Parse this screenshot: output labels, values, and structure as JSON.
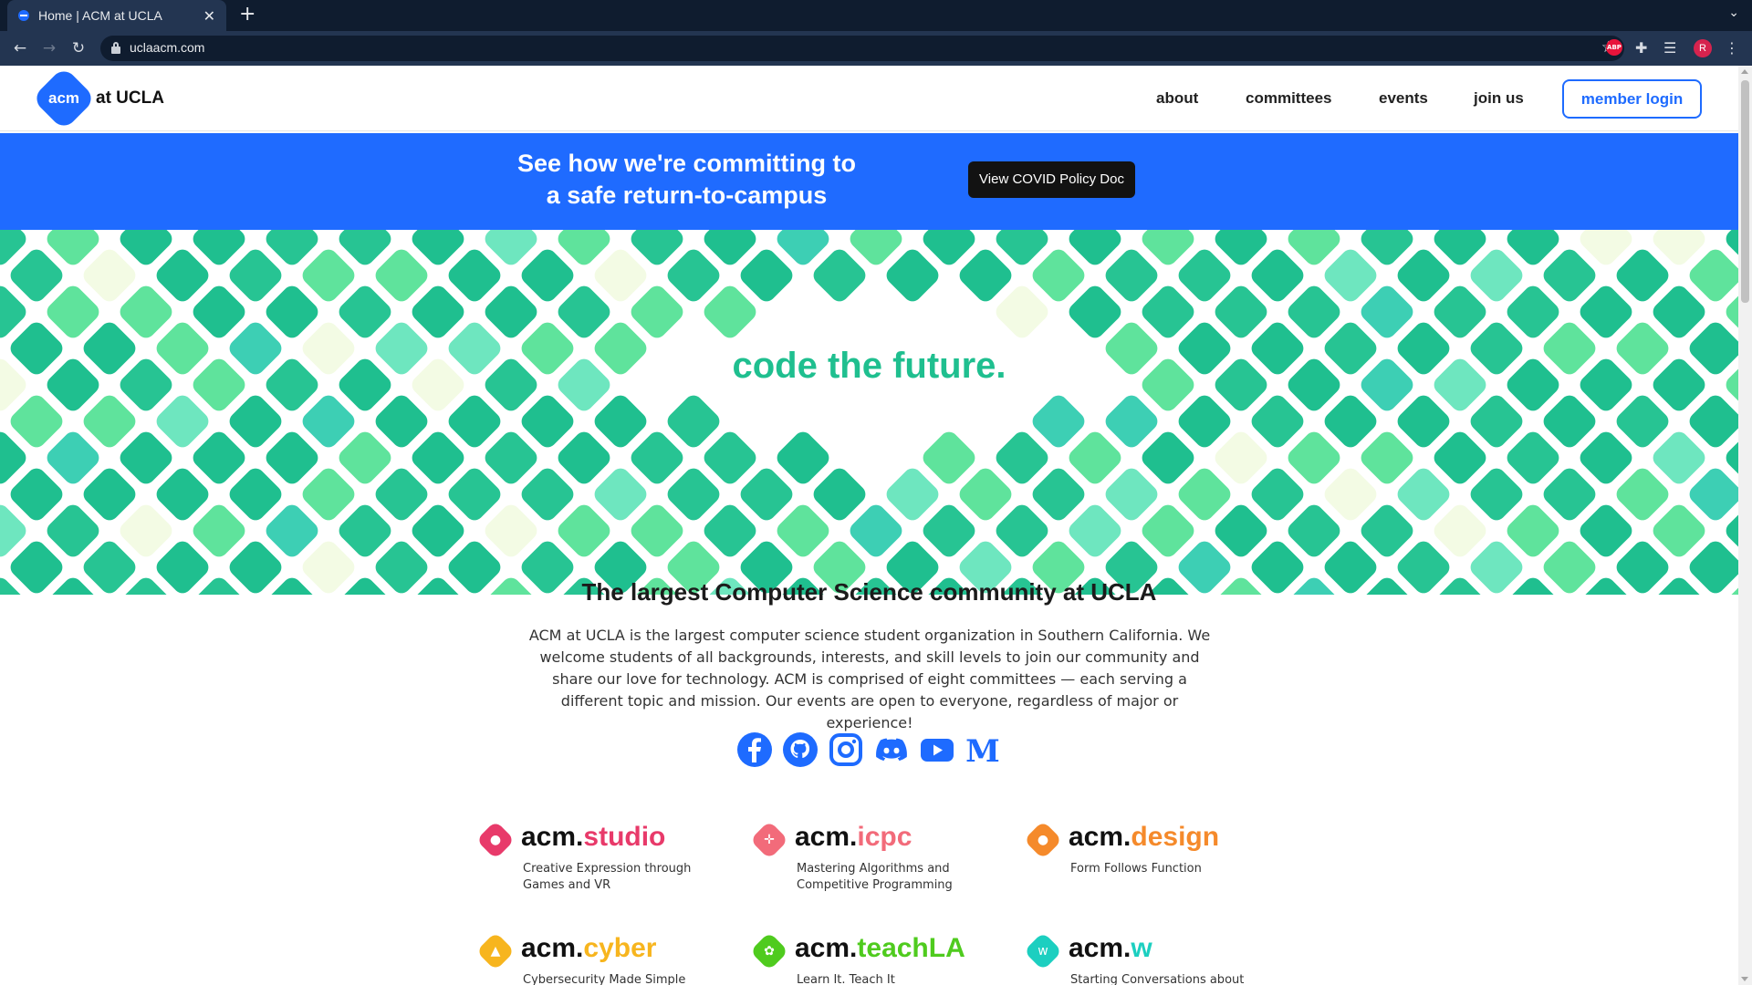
{
  "browser": {
    "tab_title": "Home | ACM at UCLA",
    "tab_close": "✕",
    "new_tab": "+",
    "url": "uclaacm.com",
    "profile_initial": "R",
    "abp_label": "ABP"
  },
  "header": {
    "logo_mark": "acm",
    "logo_text": "at UCLA",
    "nav": [
      "about",
      "committees",
      "events",
      "join us"
    ],
    "member_login": "member login"
  },
  "banner": {
    "line1": "See how we're committing to",
    "line2": "a safe return-to-campus",
    "button": "View COVID Policy Doc",
    "color": "#1f6bff"
  },
  "hero": {
    "title": "code the future.",
    "palette": [
      "#1fbf8f",
      "#27c493",
      "#5fe39c",
      "#3dcfb4",
      "#6ee6bf",
      "#f3fbe4"
    ]
  },
  "intro": {
    "title": "The largest Computer Science community at UCLA",
    "body": "ACM at UCLA is the largest computer science student organization in Southern California. We welcome students of all backgrounds, interests, and skill levels to join our community and share our love for technology. ACM is comprised of eight committees — each serving a different topic and mission. Our events are open to everyone, regardless of major or experience!"
  },
  "socials": [
    "facebook-icon",
    "github-icon",
    "instagram-icon",
    "discord-icon",
    "youtube-icon",
    "medium-icon"
  ],
  "social_color": "#1e6bff",
  "committees": [
    {
      "prefix": "acm.",
      "suffix": "studio",
      "desc": "Creative Expression through Games and VR",
      "color": "#e83a6a",
      "icon": "gamepad-icon",
      "glyph": "●"
    },
    {
      "prefix": "acm.",
      "suffix": "icpc",
      "desc": "Mastering Algorithms and Competitive Programming",
      "color": "#f26b7a",
      "icon": "arrows-icon",
      "glyph": "✛"
    },
    {
      "prefix": "acm.",
      "suffix": "design",
      "desc": "Form Follows Function",
      "color": "#f58a2b",
      "icon": "pill-icon",
      "glyph": "●"
    },
    {
      "prefix": "acm.",
      "suffix": "cyber",
      "desc": "Cybersecurity Made Simple",
      "color": "#f7b51e",
      "icon": "lock-icon",
      "glyph": "▲"
    },
    {
      "prefix": "acm.",
      "suffix": "teachLA",
      "desc": "Learn It. Teach It",
      "color": "#4fcb1e",
      "icon": "sprout-icon",
      "glyph": "✿"
    },
    {
      "prefix": "acm.",
      "suffix": "w",
      "desc": "Starting Conversations about",
      "color": "#1ccfc0",
      "icon": "w-icon",
      "glyph": "w"
    }
  ]
}
